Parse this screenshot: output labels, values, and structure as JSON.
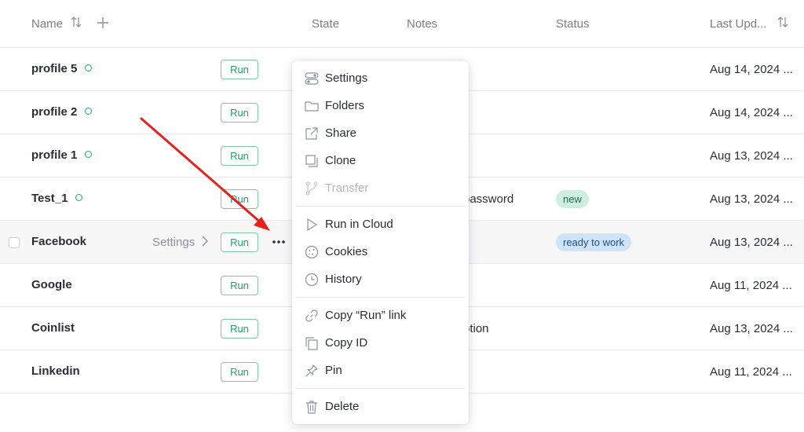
{
  "columns": {
    "name": "Name",
    "state": "State",
    "notes": "Notes",
    "status": "Status",
    "last_updated": "Last Upd..."
  },
  "run_label": "Run",
  "rows": [
    {
      "name": "profile 5",
      "date": "Aug 14, 2024 ...",
      "online_dot": true
    },
    {
      "name": "profile 2",
      "date": "Aug 14, 2024 ...",
      "online_dot": true
    },
    {
      "name": "profile 1",
      "date": "Aug 13, 2024 ...",
      "online_dot": true
    },
    {
      "name": "Test_1",
      "date": "Aug 13, 2024 ...",
      "online_dot": true,
      "note": "password",
      "status": "new"
    },
    {
      "name": "Facebook",
      "date": "Aug 13, 2024 ...",
      "settings_link": "Settings",
      "status": "ready to work"
    },
    {
      "name": "Google",
      "date": "Aug 11, 2024 ..."
    },
    {
      "name": "Coinlist",
      "date": "Aug 13, 2024 ...",
      "note": "ption"
    },
    {
      "name": "Linkedin",
      "date": "Aug 11, 2024 ..."
    }
  ],
  "badge_colors": {
    "new_bg": "#cdeee0",
    "new_text": "#1f6b4c",
    "ready_bg": "#cfe3fb",
    "ready_text": "#1f4f86"
  },
  "context_menu": {
    "items": [
      {
        "label": "Settings",
        "icon": "settings-toggle-icon"
      },
      {
        "label": "Folders",
        "icon": "folder-icon"
      },
      {
        "label": "Share",
        "icon": "share-icon"
      },
      {
        "label": "Clone",
        "icon": "clone-icon"
      },
      {
        "label": "Transfer",
        "icon": "transfer-icon",
        "disabled": true
      },
      {
        "label": "Run in Cloud",
        "icon": "play-icon"
      },
      {
        "label": "Cookies",
        "icon": "cookie-icon"
      },
      {
        "label": "History",
        "icon": "clock-icon"
      },
      {
        "label": "Copy “Run” link",
        "icon": "link-icon"
      },
      {
        "label": "Copy ID",
        "icon": "copy-icon"
      },
      {
        "label": "Pin",
        "icon": "pin-icon"
      },
      {
        "label": "Delete",
        "icon": "trash-icon"
      }
    ]
  },
  "annotation_color": "#e8201c"
}
